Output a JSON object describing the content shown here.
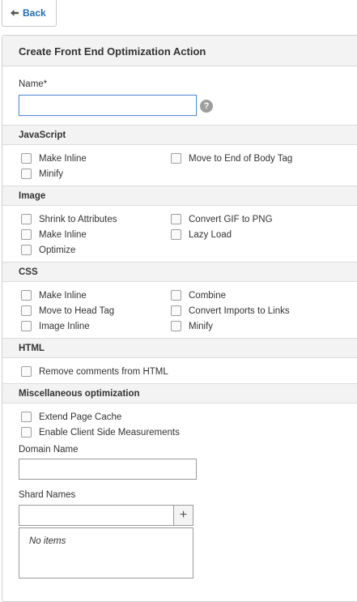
{
  "toolbar": {
    "back_label": "Back"
  },
  "panel": {
    "title": "Create Front End Optimization Action"
  },
  "name_field": {
    "label": "Name*",
    "value": "",
    "help": "?"
  },
  "sections": {
    "javascript": {
      "title": "JavaScript",
      "options": [
        "Make Inline",
        "Move to End of Body Tag",
        "Minify"
      ]
    },
    "image": {
      "title": "Image",
      "options": [
        "Shrink to Attributes",
        "Convert GIF to PNG",
        "Make Inline",
        "Lazy Load",
        "Optimize"
      ]
    },
    "css": {
      "title": "CSS",
      "options": [
        "Make Inline",
        "Combine",
        "Move to Head Tag",
        "Convert Imports to Links",
        "Image Inline",
        "Minify"
      ]
    },
    "html": {
      "title": "HTML",
      "options": [
        "Remove comments from HTML"
      ]
    },
    "misc": {
      "title": "Miscellaneous optimization",
      "options": [
        "Extend Page Cache",
        "Enable Client Side Measurements"
      ],
      "domain_label": "Domain Name",
      "domain_value": "",
      "shard_label": "Shard Names",
      "shard_value": "",
      "add_symbol": "+",
      "empty_text": "No items"
    }
  }
}
